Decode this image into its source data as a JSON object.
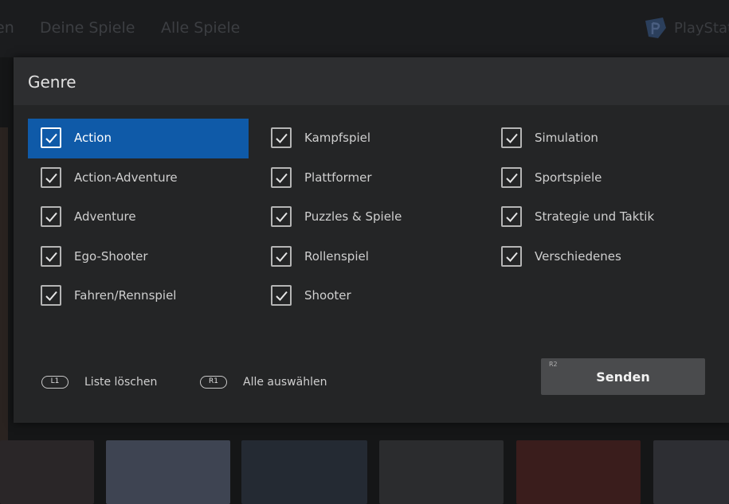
{
  "background": {
    "tabs": [
      "en",
      "Deine Spiele",
      "Alle Spiele"
    ],
    "brand": "PlayStation"
  },
  "modal": {
    "title": "Genre",
    "columns": [
      [
        {
          "label": "Action",
          "checked": true,
          "selected": true
        },
        {
          "label": "Action-Adventure",
          "checked": true
        },
        {
          "label": "Adventure",
          "checked": true
        },
        {
          "label": "Ego-Shooter",
          "checked": true
        },
        {
          "label": "Fahren/Rennspiel",
          "checked": true
        }
      ],
      [
        {
          "label": "Kampfspiel",
          "checked": true
        },
        {
          "label": "Plattformer",
          "checked": true
        },
        {
          "label": "Puzzles & Spiele",
          "checked": true
        },
        {
          "label": "Rollenspiel",
          "checked": true
        },
        {
          "label": "Shooter",
          "checked": true
        }
      ],
      [
        {
          "label": "Simulation",
          "checked": true
        },
        {
          "label": "Sportspiele",
          "checked": true
        },
        {
          "label": "Strategie und Taktik",
          "checked": true
        },
        {
          "label": "Verschiedenes",
          "checked": true
        }
      ]
    ],
    "footer": {
      "clear": {
        "button": "L1",
        "label": "Liste löschen"
      },
      "select_all": {
        "button": "R1",
        "label": "Alle auswählen"
      },
      "send": {
        "button": "R2",
        "label": "Senden"
      }
    }
  },
  "colors": {
    "selection": "#0f5aa8",
    "modal_bg": "#242526",
    "header_bg": "#2d2e30",
    "button_bg": "#4a4b4d"
  }
}
